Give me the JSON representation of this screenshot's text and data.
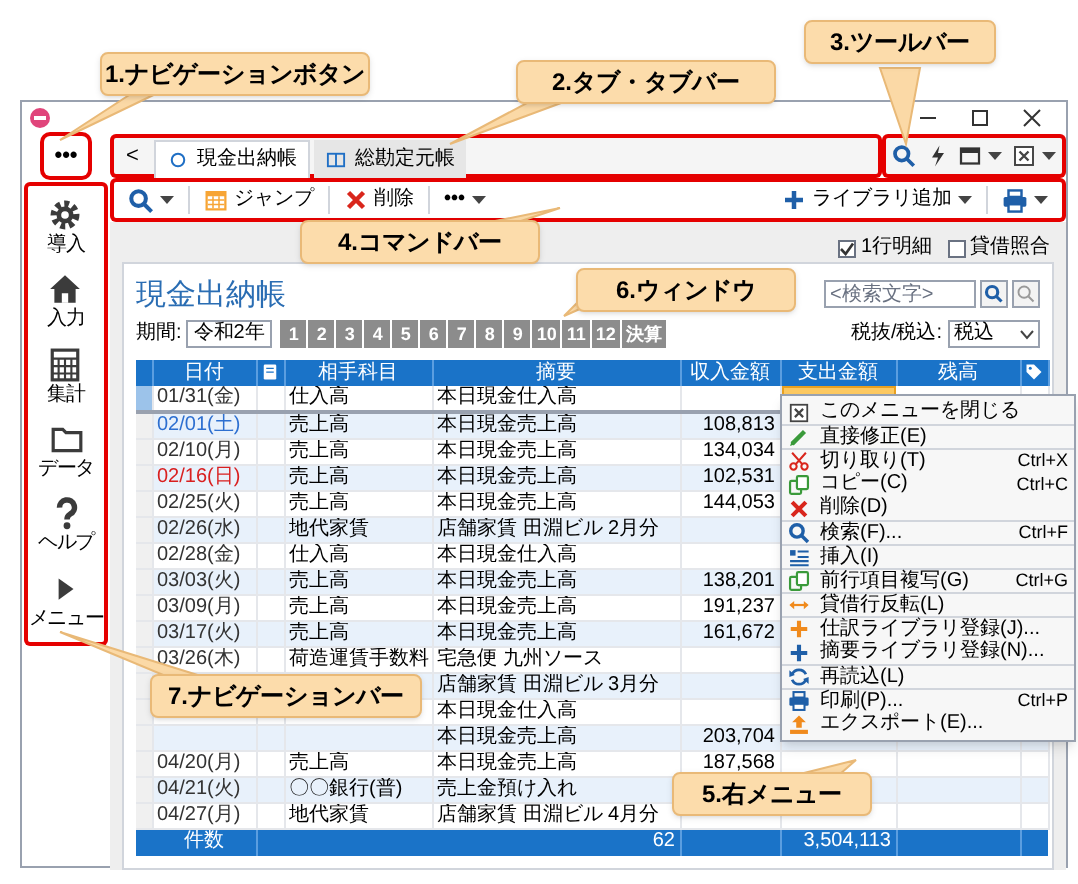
{
  "callouts": [
    {
      "text": "1.ナビゲーションボタン"
    },
    {
      "text": "2.タブ・タブバー"
    },
    {
      "text": "3.ツールバー"
    },
    {
      "text": "4.コマンドバー"
    },
    {
      "text": "5.右メニュー"
    },
    {
      "text": "6.ウィンドウ"
    },
    {
      "text": "7.ナビゲーションバー"
    }
  ],
  "nav_button": {
    "label": "•••"
  },
  "tab_bar": {
    "back": "<",
    "tabs": [
      {
        "label": "現金出納帳",
        "selected": true
      },
      {
        "label": "総勘定元帳",
        "selected": false
      }
    ]
  },
  "toolbar": [
    {
      "dropdown": false
    },
    {
      "dropdown": false
    },
    {
      "dropdown": true
    },
    {
      "dropdown": true
    }
  ],
  "command_bar": {
    "left": [
      {
        "kind": "icon",
        "dropdown": true
      },
      {
        "kind": "button",
        "label": "ジャンプ",
        "dropdown": false
      },
      {
        "kind": "button",
        "label": "削除",
        "dropdown": false
      },
      {
        "kind": "text",
        "label": "•••",
        "dropdown": true
      }
    ],
    "right": [
      {
        "kind": "button",
        "label": "ライブラリ追加",
        "dropdown": true
      },
      {
        "kind": "icon",
        "dropdown": true
      }
    ]
  },
  "sidebar": [
    {
      "label": "導入"
    },
    {
      "label": "入力"
    },
    {
      "label": "集計"
    },
    {
      "label": "データ"
    },
    {
      "label": "ヘルプ"
    },
    {
      "label": "メニュー"
    }
  ],
  "options": [
    {
      "label": "1行明細",
      "checked": true
    },
    {
      "label": "貸借照合",
      "checked": false
    }
  ],
  "page_title": "現金出納帳",
  "search": {
    "placeholder": "<検索文字>"
  },
  "period": {
    "label": "期間:",
    "value": "令和2年",
    "buttons": [
      "1",
      "2",
      "3",
      "4",
      "5",
      "6",
      "7",
      "8",
      "9",
      "10",
      "11",
      "12",
      "決算"
    ]
  },
  "tax": {
    "label": "税抜/税込:",
    "value": "税込"
  },
  "table": {
    "columns": [
      {
        "kind": "blank"
      },
      {
        "kind": "text",
        "label": "日付"
      },
      {
        "kind": "icon"
      },
      {
        "kind": "text",
        "label": "相手科目"
      },
      {
        "kind": "text",
        "label": "摘要"
      },
      {
        "kind": "text",
        "label": "収入金額"
      },
      {
        "kind": "text",
        "label": "支出金額"
      },
      {
        "kind": "text",
        "label": "残高"
      },
      {
        "kind": "icon"
      }
    ],
    "rows": [
      {
        "date": "01/31(金)",
        "color": "#333333",
        "account": "仕入高",
        "summary": "本日現金仕入高",
        "selected": true
      },
      {
        "date": "02/01(土)",
        "color": "#2d6fd0",
        "account": "売上高",
        "summary": "本日現金売上高",
        "income": "108,813",
        "selected": false
      },
      {
        "date": "02/10(月)",
        "color": "#333333",
        "account": "売上高",
        "summary": "本日現金売上高",
        "income": "134,034",
        "selected": false
      },
      {
        "date": "02/16(日)",
        "color": "#d92020",
        "account": "売上高",
        "summary": "本日現金売上高",
        "income": "102,531",
        "selected": false
      },
      {
        "date": "02/25(火)",
        "color": "#333333",
        "account": "売上高",
        "summary": "本日現金売上高",
        "income": "144,053",
        "selected": false
      },
      {
        "date": "02/26(水)",
        "color": "#333333",
        "account": "地代家賃",
        "summary": "店舗家賃 田淵ビル 2月分",
        "selected": false
      },
      {
        "date": "02/28(金)",
        "color": "#333333",
        "account": "仕入高",
        "summary": "本日現金仕入高",
        "selected": false
      },
      {
        "date": "03/03(火)",
        "color": "#333333",
        "account": "売上高",
        "summary": "本日現金売上高",
        "income": "138,201",
        "selected": false
      },
      {
        "date": "03/09(月)",
        "color": "#333333",
        "account": "売上高",
        "summary": "本日現金売上高",
        "income": "191,237",
        "selected": false
      },
      {
        "date": "03/17(火)",
        "color": "#333333",
        "account": "売上高",
        "summary": "本日現金売上高",
        "income": "161,672",
        "selected": false
      },
      {
        "date": "03/26(木)",
        "color": "#333333",
        "account": "荷造運賃手数料",
        "summary": "宅急便 九州ソース",
        "selected": false
      },
      {
        "summary": "店舗家賃 田淵ビル 3月分",
        "selected": false
      },
      {
        "summary": "本日現金仕入高",
        "selected": false
      },
      {
        "summary": "本日現金売上高",
        "income": "203,704",
        "selected": false
      },
      {
        "date": "04/20(月)",
        "color": "#333333",
        "account": "売上高",
        "summary": "本日現金売上高",
        "income": "187,568",
        "selected": false
      },
      {
        "date": "04/21(火)",
        "color": "#333333",
        "account": "〇〇銀行(普)",
        "summary": "売上金預け入れ",
        "selected": false
      },
      {
        "date": "04/27(月)",
        "color": "#333333",
        "account": "地代家賃",
        "summary": "店舗家賃 田淵ビル 4月分",
        "selected": false
      }
    ],
    "footer": {
      "label": "件数",
      "count": "62",
      "expense_total": "3,504,113"
    }
  },
  "context_menu": [
    {
      "label": "このメニューを閉じる",
      "separator_above": false
    },
    {
      "label": "直接修正(E)",
      "separator_above": true
    },
    {
      "label": "切り取り(T)",
      "shortcut": "Ctrl+X",
      "separator_above": true
    },
    {
      "label": "コピー(C)",
      "shortcut": "Ctrl+C",
      "separator_above": false
    },
    {
      "label": "削除(D)",
      "separator_above": false
    },
    {
      "label": "検索(F)...",
      "shortcut": "Ctrl+F",
      "separator_above": true
    },
    {
      "label": "挿入(I)",
      "separator_above": true
    },
    {
      "label": "前行項目複写(G)",
      "shortcut": "Ctrl+G",
      "separator_above": true
    },
    {
      "label": "貸借行反転(L)",
      "separator_above": true
    },
    {
      "label": "仕訳ライブラリ登録(J)...",
      "separator_above": true
    },
    {
      "label": "摘要ライブラリ登録(N)...",
      "separator_above": false
    },
    {
      "label": "再読込(L)",
      "separator_above": true
    },
    {
      "label": "印刷(P)...",
      "shortcut": "Ctrl+P",
      "separator_above": true
    },
    {
      "label": "エクスポート(E)...",
      "separator_above": false
    }
  ]
}
